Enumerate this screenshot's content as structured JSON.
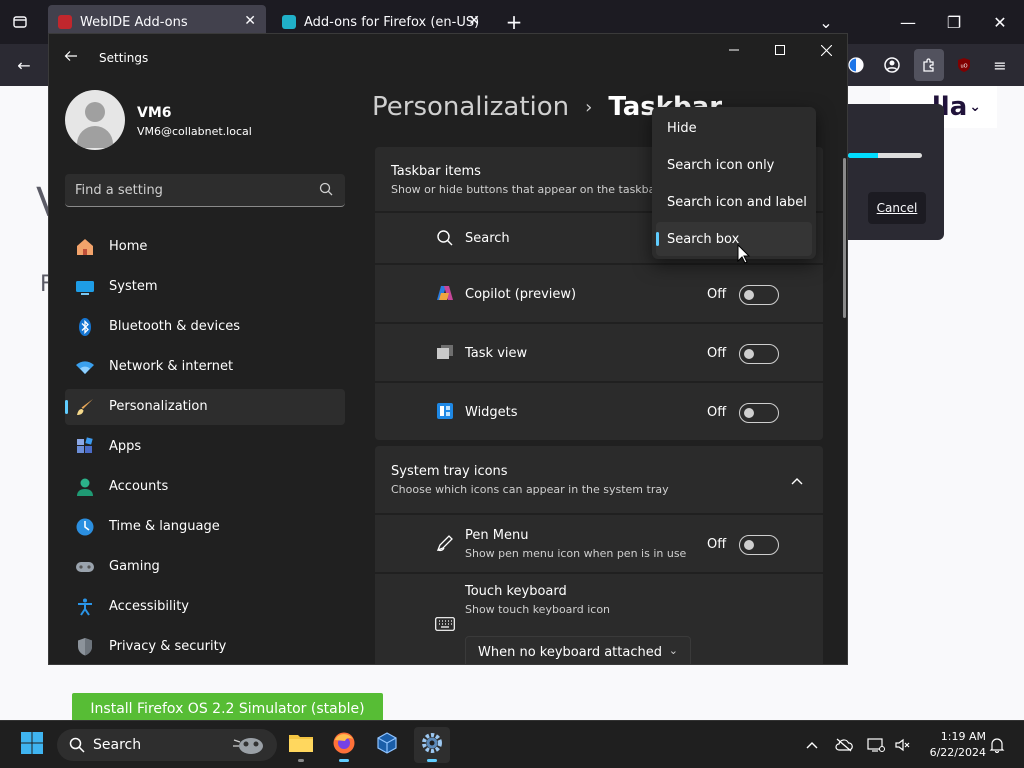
{
  "firefox": {
    "tabs": [
      {
        "label": "WebIDE Add-ons",
        "active": true
      },
      {
        "label": "Add-ons for Firefox (en-US)",
        "active": false
      }
    ],
    "install_button": "Install Firefox OS 2.2 Simulator (stable)",
    "logo_text": "lla",
    "download": {
      "cancel_label": "Cancel",
      "progress": 0.4
    },
    "ghost_letters": [
      "V",
      "F"
    ]
  },
  "settings": {
    "app_title": "Settings",
    "profile": {
      "name": "VM6",
      "email": "VM6@collabnet.local"
    },
    "search_placeholder": "Find a setting",
    "nav": [
      {
        "label": "Home",
        "icon": "home-icon",
        "selected": false
      },
      {
        "label": "System",
        "icon": "system-icon",
        "selected": false
      },
      {
        "label": "Bluetooth & devices",
        "icon": "bluetooth-icon",
        "selected": false
      },
      {
        "label": "Network & internet",
        "icon": "wifi-icon",
        "selected": false
      },
      {
        "label": "Personalization",
        "icon": "brush-icon",
        "selected": true
      },
      {
        "label": "Apps",
        "icon": "apps-icon",
        "selected": false
      },
      {
        "label": "Accounts",
        "icon": "accounts-icon",
        "selected": false
      },
      {
        "label": "Time & language",
        "icon": "globe-icon",
        "selected": false
      },
      {
        "label": "Gaming",
        "icon": "gamepad-icon",
        "selected": false
      },
      {
        "label": "Accessibility",
        "icon": "accessibility-icon",
        "selected": false
      },
      {
        "label": "Privacy & security",
        "icon": "shield-icon",
        "selected": false
      }
    ],
    "breadcrumb": {
      "parent": "Personalization",
      "separator": "›",
      "current": "Taskbar"
    },
    "taskbar_items": {
      "title": "Taskbar items",
      "subtitle": "Show or hide buttons that appear on the taskbar",
      "rows": [
        {
          "label": "Search",
          "icon": "search-icon"
        },
        {
          "label": "Copilot (preview)",
          "icon": "copilot-icon",
          "state": "Off"
        },
        {
          "label": "Task view",
          "icon": "task-view-icon",
          "state": "Off"
        },
        {
          "label": "Widgets",
          "icon": "widgets-icon",
          "state": "Off"
        }
      ]
    },
    "system_tray": {
      "title": "System tray icons",
      "subtitle": "Choose which icons can appear in the system tray",
      "pen_menu": {
        "label": "Pen Menu",
        "sub": "Show pen menu icon when pen is in use",
        "state": "Off"
      },
      "touch_keyboard": {
        "label": "Touch keyboard",
        "sub": "Show touch keyboard icon",
        "dropdown_value": "When no keyboard attached"
      }
    },
    "search_flyout": {
      "options": [
        "Hide",
        "Search icon only",
        "Search icon and label",
        "Search box"
      ],
      "selected_index": 3
    }
  },
  "taskbar": {
    "search_label": "Search",
    "time": "1:19 AM",
    "date": "6/22/2024",
    "accent": "#60cdff"
  }
}
